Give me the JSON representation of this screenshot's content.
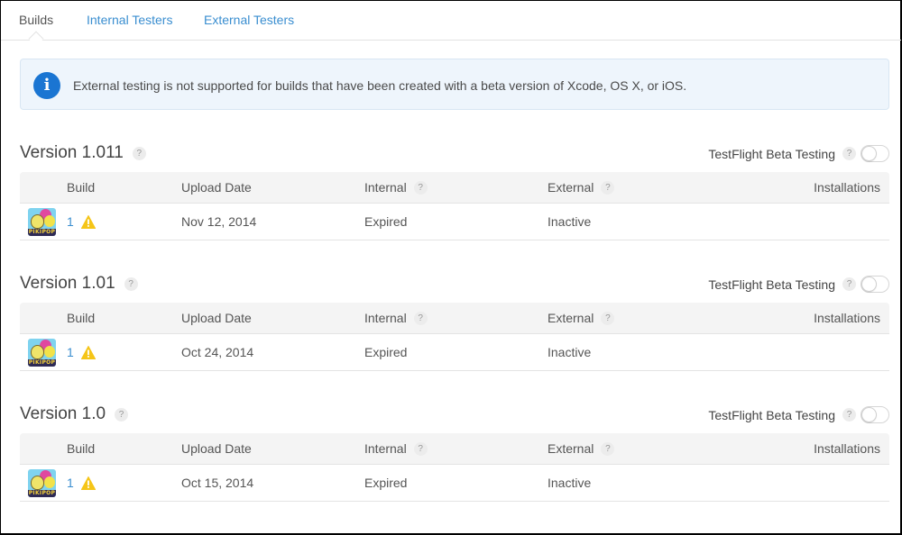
{
  "tabs": [
    {
      "label": "Builds",
      "active": true
    },
    {
      "label": "Internal Testers",
      "active": false
    },
    {
      "label": "External Testers",
      "active": false
    }
  ],
  "banner": {
    "icon": "info-icon",
    "text": "External testing is not supported for builds that have been created with a beta version of Xcode, OS X, or iOS."
  },
  "colors": {
    "link": "#3a8ed0",
    "info_icon": "#1a75d2",
    "banner_bg": "#eef5fc",
    "warning": "#f5c518"
  },
  "columns": {
    "build": "Build",
    "upload_date": "Upload Date",
    "internal": "Internal",
    "external": "External",
    "installations": "Installations",
    "help": "?"
  },
  "testflight_label": "TestFlight Beta Testing",
  "sections": [
    {
      "version": "Version 1.011",
      "help": "?",
      "testflight_enabled": false,
      "builds": [
        {
          "app_icon": "app-icon",
          "build": "1",
          "warning_icon": "warning-icon",
          "upload_date": "Nov 12, 2014",
          "internal": "Expired",
          "external": "Inactive",
          "installations": ""
        }
      ]
    },
    {
      "version": "Version 1.01",
      "help": "?",
      "testflight_enabled": false,
      "builds": [
        {
          "app_icon": "app-icon",
          "build": "1",
          "warning_icon": "warning-icon",
          "upload_date": "Oct 24, 2014",
          "internal": "Expired",
          "external": "Inactive",
          "installations": ""
        }
      ]
    },
    {
      "version": "Version 1.0",
      "help": "?",
      "testflight_enabled": false,
      "builds": [
        {
          "app_icon": "app-icon",
          "build": "1",
          "warning_icon": "warning-icon",
          "upload_date": "Oct 15, 2014",
          "internal": "Expired",
          "external": "Inactive",
          "installations": ""
        }
      ]
    }
  ]
}
